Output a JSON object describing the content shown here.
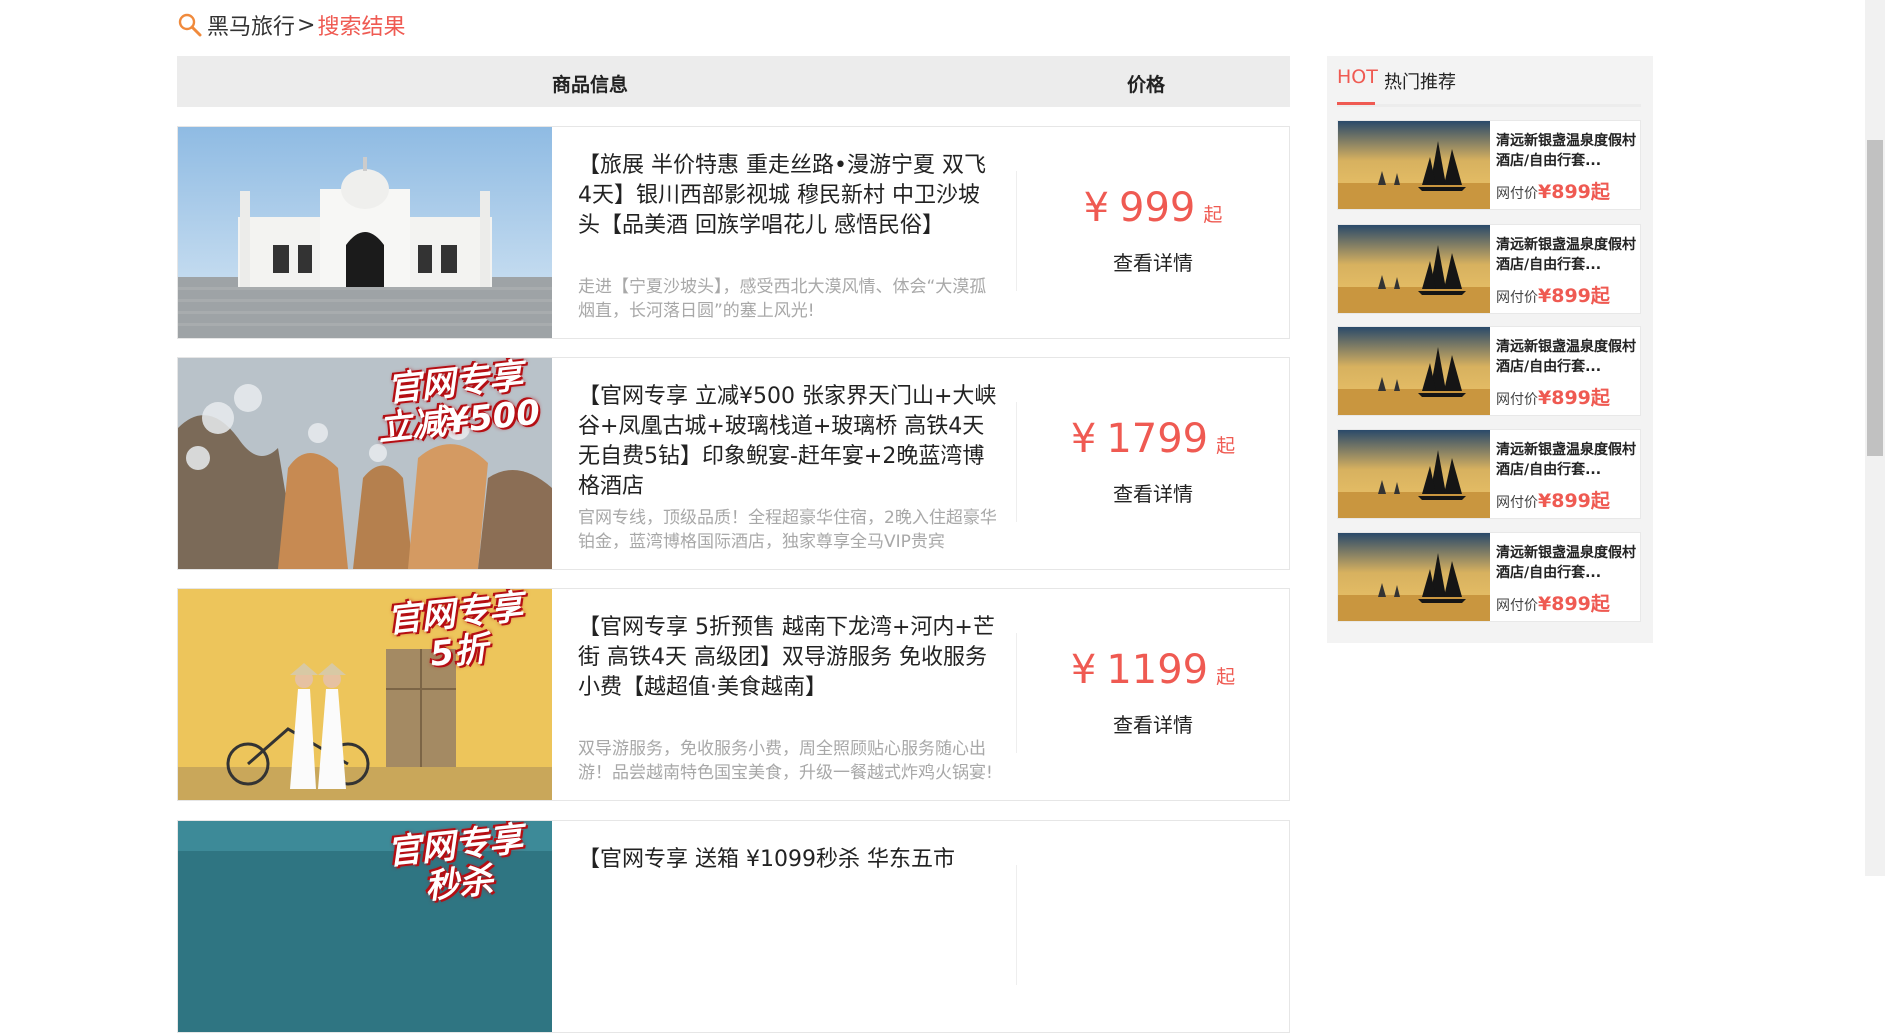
{
  "breadcrumb": {
    "home": "黑马旅行",
    "separator": ">",
    "current": "搜索结果"
  },
  "table_header": {
    "info": "商品信息",
    "price": "价格"
  },
  "products": [
    {
      "title": "【旅展 半价特惠 重走丝路•漫游宁夏 双飞4天】银川西部影视城 穆民新村 中卫沙坡头【品美酒 回族学唱花儿 感悟民俗】",
      "desc": "走进【宁夏沙坡头】，感受西北大漠风情、体会“大漠孤烟直，长河落日圆”的塞上风光!",
      "currency": "¥",
      "price": "999",
      "suffix": "起",
      "detail": "查看详情",
      "image": "mosque-photo"
    },
    {
      "title": "【官网专享 立减¥500 张家界天门山+大峡谷+凤凰古城+玻璃栈道+玻璃桥 高铁4天 无自费5钻】印象鲵宴-赶年宴+2晚蓝湾博格酒店",
      "desc": "官网专线，顶级品质！全程超豪华住宿，2晚入住超豪华铂金，蓝湾博格国际酒店，独家尊享全马VIP贵宾",
      "badge_line1": "官网专享",
      "badge_line2": "立减¥500",
      "currency": "¥",
      "price": "1799",
      "suffix": "起",
      "detail": "查看详情",
      "image": "mountain-photo"
    },
    {
      "title": "【官网专享 5折预售 越南下龙湾+河内+芒街 高铁4天 高级团】双导游服务 免收服务小费【越超值·美食越南】",
      "desc": "双导游服务，免收服务小费，周全照顾贴心服务随心出游！品尝越南特色国宝美食，升级一餐越式炸鸡火锅宴!",
      "badge_line1": "官网专享",
      "badge_line2": "5折",
      "currency": "¥",
      "price": "1199",
      "suffix": "起",
      "detail": "查看详情",
      "image": "vietnam-photo"
    },
    {
      "title": "【官网专享 送箱 ¥1099秒杀 华东五市",
      "desc": "",
      "badge_line1": "官网专享",
      "badge_line2": "秒杀",
      "currency": "¥",
      "price": "",
      "suffix": "",
      "detail": "",
      "image": "sea-photo"
    }
  ],
  "sidebar": {
    "tab_hot": "HOT",
    "tab_label": "热门推荐",
    "items": [
      {
        "title": "清远新银盏温泉度假村酒店/自由行套...",
        "price_label": "网付价",
        "price": "¥899起"
      },
      {
        "title": "清远新银盏温泉度假村酒店/自由行套...",
        "price_label": "网付价",
        "price": "¥899起"
      },
      {
        "title": "清远新银盏温泉度假村酒店/自由行套...",
        "price_label": "网付价",
        "price": "¥899起"
      },
      {
        "title": "清远新银盏温泉度假村酒店/自由行套...",
        "price_label": "网付价",
        "price": "¥899起"
      },
      {
        "title": "清远新银盏温泉度假村酒店/自由行套...",
        "price_label": "网付价",
        "price": "¥899起"
      }
    ]
  },
  "colors": {
    "accent": "#ef5a52",
    "header_bg": "#ececec",
    "sidebar_bg": "#f3f3f3"
  }
}
